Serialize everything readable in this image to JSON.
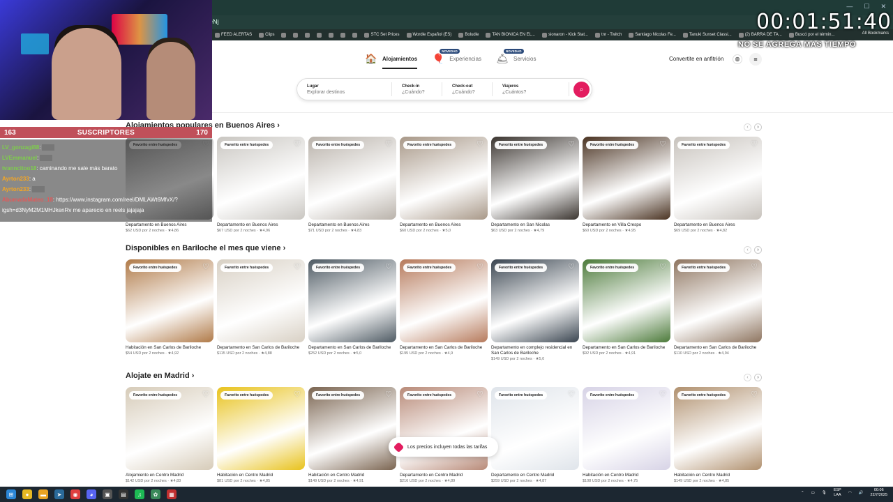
{
  "browser": {
    "address_fragment": "eNj",
    "bookmarks": [
      "FEED ALERTAS",
      "Clips",
      "",
      "",
      "",
      "",
      "",
      "",
      "",
      "STC Set Prices",
      "Wordle Español (ES)",
      "Boludle",
      "TAN BIONICA EN EL...",
      "sionaron - Kick Stat...",
      "tnr - Twitch",
      "Santiago Nicolas Fe...",
      "Tanuki Sunset Classi...",
      "(2) BARRA DE TA...",
      "Buscó por el términ..."
    ],
    "all_bookmarks": "All Bookmarks"
  },
  "airbnb": {
    "tabs": [
      {
        "label": "Alojamientos",
        "icon": "house-icon",
        "badge": ""
      },
      {
        "label": "Experiencias",
        "icon": "balloon-icon",
        "badge": "NOVEDAD"
      },
      {
        "label": "Servicios",
        "icon": "service-bell-icon",
        "badge": "NOVEDAD"
      }
    ],
    "host_link": "Convertite en anfitrión",
    "search": {
      "lugar_label": "Lugar",
      "lugar_placeholder": "Explorar destinos",
      "checkin_label": "Check-in",
      "checkin_placeholder": "¿Cuándo?",
      "checkout_label": "Check-out",
      "checkout_placeholder": "¿Cuándo?",
      "viajeros_label": "Viajeros",
      "viajeros_placeholder": "¿Cuántos?"
    },
    "badge_text": "Favorito entre huéspedes",
    "sections": [
      {
        "title": "Alojamientos populares en Buenos Aires ›",
        "cards": [
          {
            "title": "Departamento en Buenos Aires",
            "price": "$62 USD por 2 noches · ★4,86",
            "color": "#8a8a8a"
          },
          {
            "title": "Departamento en Buenos Aires",
            "price": "$67 USD por 2 noches · ★4,96",
            "color": "#c9c6c1"
          },
          {
            "title": "Departamento en Buenos Aires",
            "price": "$71 USD por 2 noches · ★4,83",
            "color": "#b9b2aa"
          },
          {
            "title": "Departamento en Buenos Aires",
            "price": "$60 USD por 2 noches · ★5,0",
            "color": "#a89888"
          },
          {
            "title": "Departamento en San Nicolas",
            "price": "$63 USD por 2 noches · ★4,79",
            "color": "#3b3530"
          },
          {
            "title": "Departamento en Villa Crespo",
            "price": "$60 USD por 2 noches · ★4,95",
            "color": "#4a3322"
          },
          {
            "title": "Departamento en Buenos Aires",
            "price": "$69 USD por 2 noches · ★4,82",
            "color": "#c7c2bc"
          }
        ]
      },
      {
        "title": "Disponibles en Bariloche el mes que viene ›",
        "cards": [
          {
            "title": "Habitación en San Carlos de Bariloche",
            "price": "$54 USD por 2 noches · ★4,92",
            "color": "#b07a48"
          },
          {
            "title": "Departamento en San Carlos de Bariloche",
            "price": "$115 USD por 2 noches · ★4,88",
            "color": "#d8d0c4"
          },
          {
            "title": "Departamento en San Carlos de Bariloche",
            "price": "$252 USD por 2 noches · ★5,0",
            "color": "#4e5a63"
          },
          {
            "title": "Departamento en San Carlos de Bariloche",
            "price": "$195 USD por 2 noches · ★4,9",
            "color": "#b67a5c"
          },
          {
            "title": "Departamento en complejo residencial en San Carlos de Bariloche",
            "price": "$149 USD por 2 noches · ★5,0",
            "color": "#3a4550"
          },
          {
            "title": "Departamento en San Carlos de Bariloche",
            "price": "$92 USD por 2 noches · ★4,91",
            "color": "#4c7a3a"
          },
          {
            "title": "Departamento en San Carlos de Bariloche",
            "price": "$110 USD por 2 noches · ★4,94",
            "color": "#8e7560"
          }
        ]
      },
      {
        "title": "Alojate en Madrid ›",
        "cards": [
          {
            "title": "Alojamiento en Centro Madrid",
            "price": "$142 USD por 2 noches · ★4,83",
            "color": "#d6cbb8"
          },
          {
            "title": "Habitación en Centro Madrid",
            "price": "$81 USD por 2 noches · ★4,85",
            "color": "#e8c21c"
          },
          {
            "title": "Habitación en Centro Madrid",
            "price": "$149 USD por 2 noches · ★4,91",
            "color": "#7a6450"
          },
          {
            "title": "Departamento en Centro Madrid",
            "price": "$216 USD por 2 noches · ★4,89",
            "color": "#b88a78"
          },
          {
            "title": "Departamento en Centro Madrid",
            "price": "$259 USD por 2 noches · ★4,87",
            "color": "#dfe4ea"
          },
          {
            "title": "Habitación en Centro Madrid",
            "price": "$108 USD por 2 noches · ★4,75",
            "color": "#d7d3e6"
          },
          {
            "title": "Habitación en Centro Madrid",
            "price": "$149 USD por 2 noches · ★4,85",
            "color": "#b0906e"
          }
        ]
      }
    ],
    "toast": "Los precios incluyen todas las tarifas"
  },
  "stream": {
    "timer": "00:01:51:40",
    "timer_sub": "NO SE AGREGA MAS TIEMPO",
    "subs_current": "163",
    "subs_label": "SUSCRIPTORES",
    "subs_goal": "170",
    "chat": [
      {
        "user": "LV_gonzagi88",
        "msg": ":",
        "cls": "u1"
      },
      {
        "user": "LVEmmanuel",
        "msg": ":",
        "cls": "u1"
      },
      {
        "user": "tvanncitoo18",
        "msg": ": caminando me sale más barato",
        "cls": "u1"
      },
      {
        "user": "Ayrton233",
        "msg": ": a",
        "cls": "u2"
      },
      {
        "user": "Ayrton233",
        "msg": ":",
        "cls": "u2"
      },
      {
        "user": "AbumadaMateo_18",
        "msg": ": https://www.instagram.com/reel/DMLAWt6MfvX/?",
        "cls": "u3"
      },
      {
        "user": "",
        "msg": "igsh=d3NyM2M1MHJkenRv me aparecio en reels jajajaja",
        "cls": ""
      }
    ]
  },
  "taskbar": {
    "lang": "ESP",
    "lang2": "LAA",
    "time": "00:06",
    "date": "22/7/2025"
  }
}
